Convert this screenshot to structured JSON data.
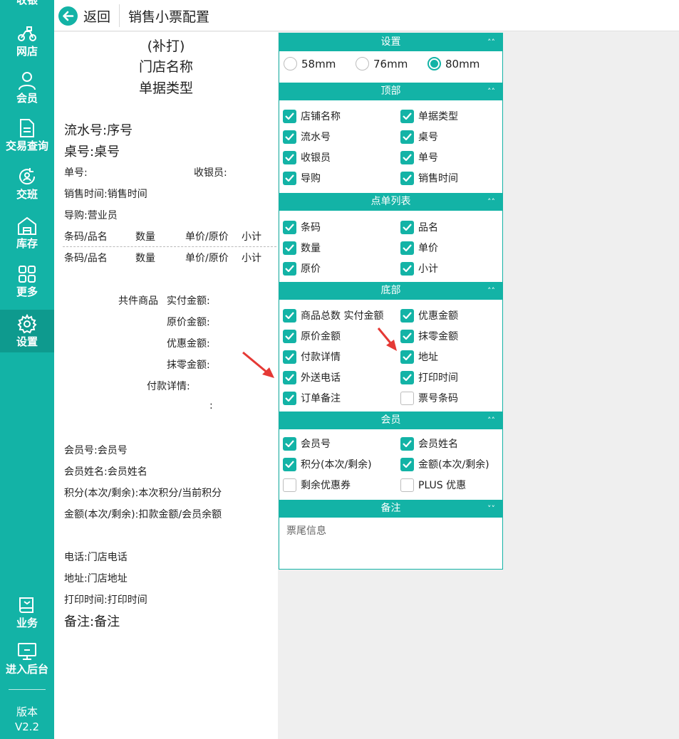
{
  "sidebar": {
    "items": [
      {
        "label": "收银",
        "icon": "cashier-icon"
      },
      {
        "label": "网店",
        "icon": "scooter-icon"
      },
      {
        "label": "会员",
        "icon": "person-icon"
      },
      {
        "label": "交易查询",
        "icon": "document-icon"
      },
      {
        "label": "交班",
        "icon": "shift-icon"
      },
      {
        "label": "库存",
        "icon": "warehouse-icon"
      },
      {
        "label": "更多",
        "icon": "grid-icon"
      },
      {
        "label": "设置",
        "icon": "gear-icon"
      },
      {
        "label": "业务",
        "icon": "book-icon"
      },
      {
        "label": "进入后台",
        "icon": "monitor-icon"
      }
    ],
    "active": "设置",
    "version_label": "版本",
    "version_value": "V2.2"
  },
  "header": {
    "back_label": "返回",
    "title": "销售小票配置"
  },
  "preview": {
    "reprint": "(补打)",
    "store_name": "门店名称",
    "doc_type": "单据类型",
    "serial": "流水号:序号",
    "table": "桌号:桌号",
    "order_no": "单号:",
    "cashier": "收银员:",
    "sale_time": "销售时间:销售时间",
    "guide": "导购:营业员",
    "cols": [
      "条码/品名",
      "数量",
      "单价/原价",
      "小计"
    ],
    "total_items": "共件商品",
    "paid": "实付金额:",
    "original": "原价金额:",
    "discount": "优惠金额:",
    "rounding": "抹零金额:",
    "payment_detail": "付款详情:",
    "colon": ":",
    "member_no": "会员号:会员号",
    "member_name": "会员姓名:会员姓名",
    "points": "积分(本次/剩余):本次积分/当前积分",
    "amount": "金额(本次/剩余):扣款金额/会员余额",
    "phone": "电话:门店电话",
    "address": "地址:门店地址",
    "print_time": "打印时间:打印时间",
    "remark": "备注:备注"
  },
  "settings": {
    "header": "设置",
    "paper_sizes": [
      {
        "label": "58mm",
        "selected": false
      },
      {
        "label": "76mm",
        "selected": false
      },
      {
        "label": "80mm",
        "selected": true
      }
    ]
  },
  "top": {
    "header": "顶部",
    "options": [
      {
        "label": "店铺名称",
        "checked": true
      },
      {
        "label": "单据类型",
        "checked": true
      },
      {
        "label": "流水号",
        "checked": true
      },
      {
        "label": "桌号",
        "checked": true
      },
      {
        "label": "收银员",
        "checked": true
      },
      {
        "label": "单号",
        "checked": true
      },
      {
        "label": "导购",
        "checked": true
      },
      {
        "label": "销售时间",
        "checked": true
      }
    ]
  },
  "order_list": {
    "header": "点单列表",
    "options": [
      {
        "label": "条码",
        "checked": true
      },
      {
        "label": "品名",
        "checked": true
      },
      {
        "label": "数量",
        "checked": true
      },
      {
        "label": "单价",
        "checked": true
      },
      {
        "label": "原价",
        "checked": true
      },
      {
        "label": "小计",
        "checked": true
      }
    ]
  },
  "bottom": {
    "header": "底部",
    "options": [
      {
        "label": "商品总数 实付金额",
        "checked": true
      },
      {
        "label": "优惠金额",
        "checked": true
      },
      {
        "label": "原价金额",
        "checked": true
      },
      {
        "label": "抹零金额",
        "checked": true
      },
      {
        "label": "付款详情",
        "checked": true
      },
      {
        "label": "地址",
        "checked": true
      },
      {
        "label": "外送电话",
        "checked": true
      },
      {
        "label": "打印时间",
        "checked": true
      },
      {
        "label": "订单备注",
        "checked": true
      },
      {
        "label": "票号条码",
        "checked": false
      }
    ]
  },
  "member": {
    "header": "会员",
    "options": [
      {
        "label": "会员号",
        "checked": true
      },
      {
        "label": "会员姓名",
        "checked": true
      },
      {
        "label": "积分(本次/剩余)",
        "checked": true
      },
      {
        "label": "金额(本次/剩余)",
        "checked": true
      },
      {
        "label": "剩余优惠券",
        "checked": false
      },
      {
        "label": "PLUS 优惠",
        "checked": false
      }
    ]
  },
  "remark": {
    "header": "备注",
    "placeholder": "票尾信息"
  },
  "colors": {
    "accent": "#13b3a6",
    "arrow": "#e53935"
  }
}
